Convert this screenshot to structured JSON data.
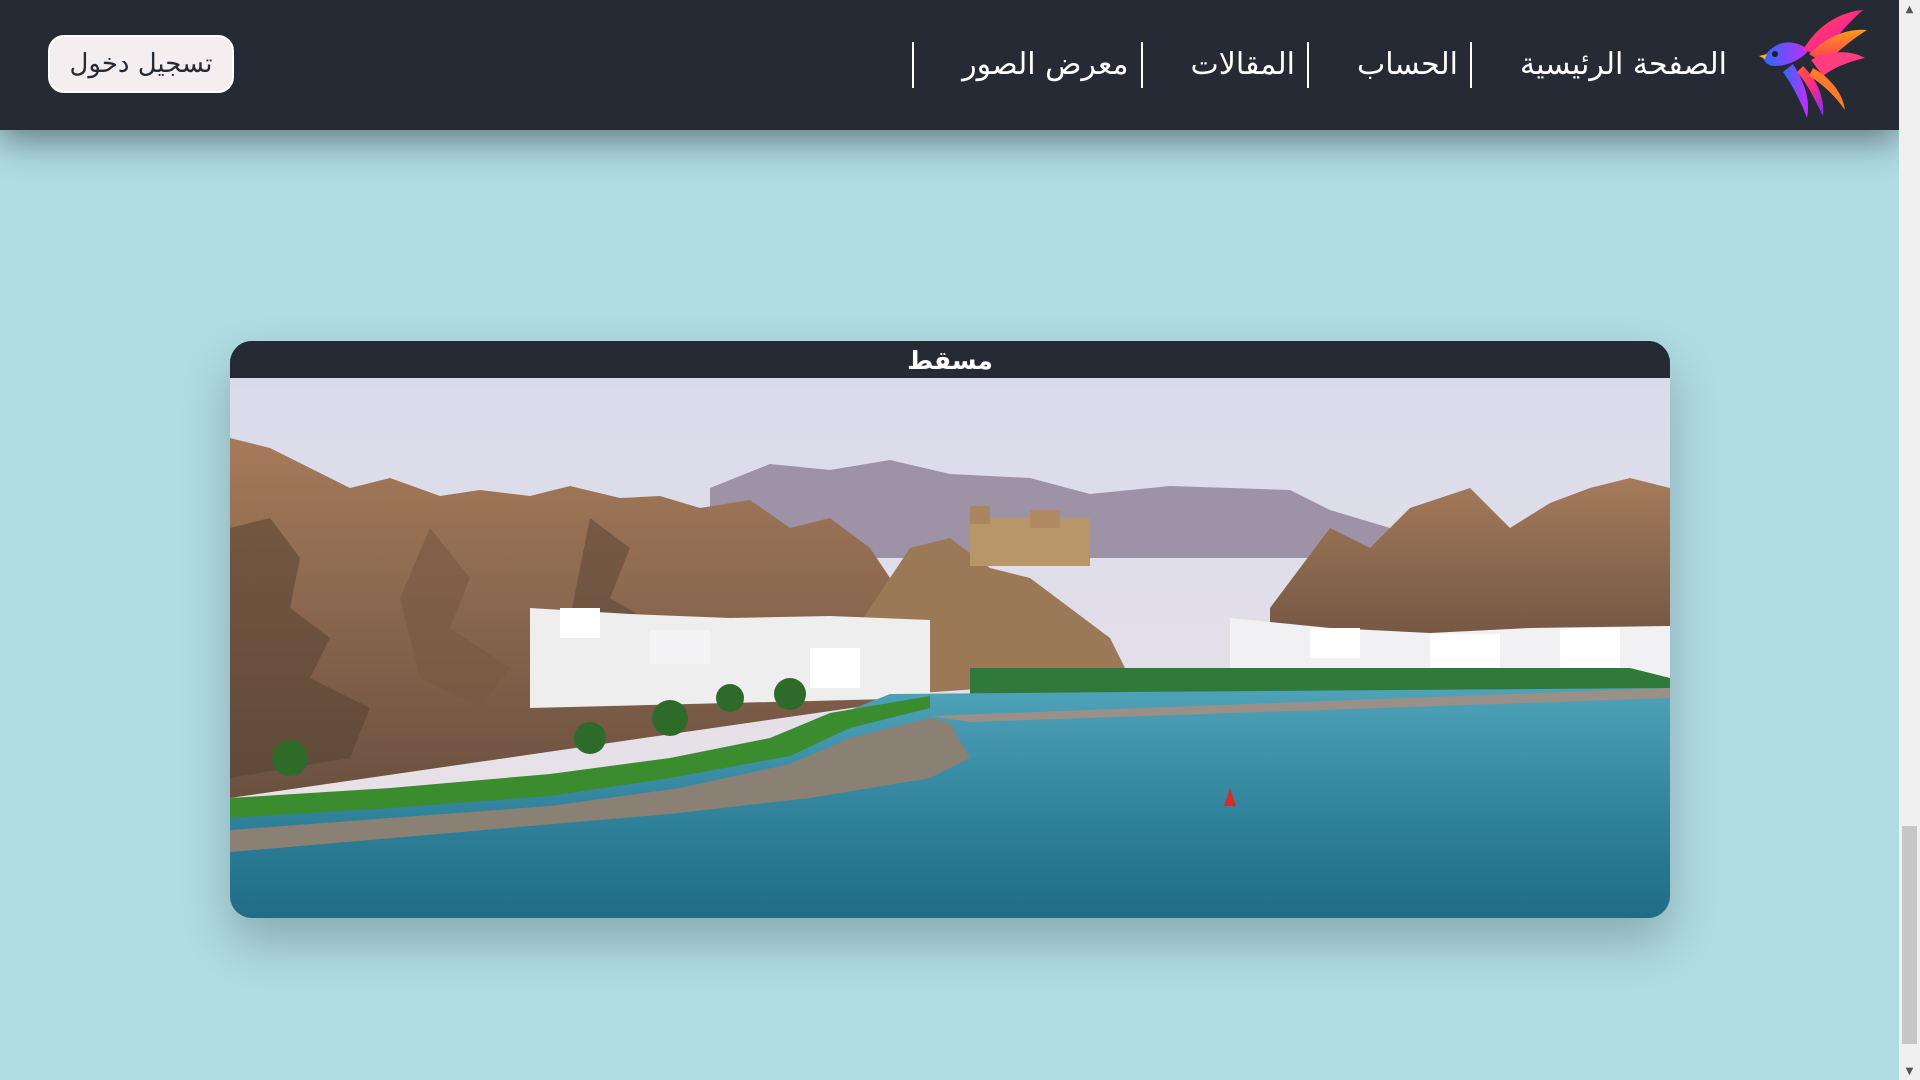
{
  "header": {
    "logo_icon": "phoenix-bird-icon",
    "nav": [
      {
        "label": "الصفحة الرئيسية"
      },
      {
        "label": "الحساب"
      },
      {
        "label": "المقالات"
      },
      {
        "label": "معرض الصور"
      }
    ],
    "login_label": "تسجيل دخول"
  },
  "card": {
    "title": "مسقط",
    "image": "muscat-coastline-photo"
  },
  "scrollbar": {
    "up_icon": "scroll-up-arrow-icon",
    "down_icon": "scroll-down-arrow-icon"
  },
  "colors": {
    "header_bg": "#262a35",
    "page_bg": "#b0dbe3",
    "button_bg": "#f5eef0",
    "text_light": "#ffffff"
  }
}
